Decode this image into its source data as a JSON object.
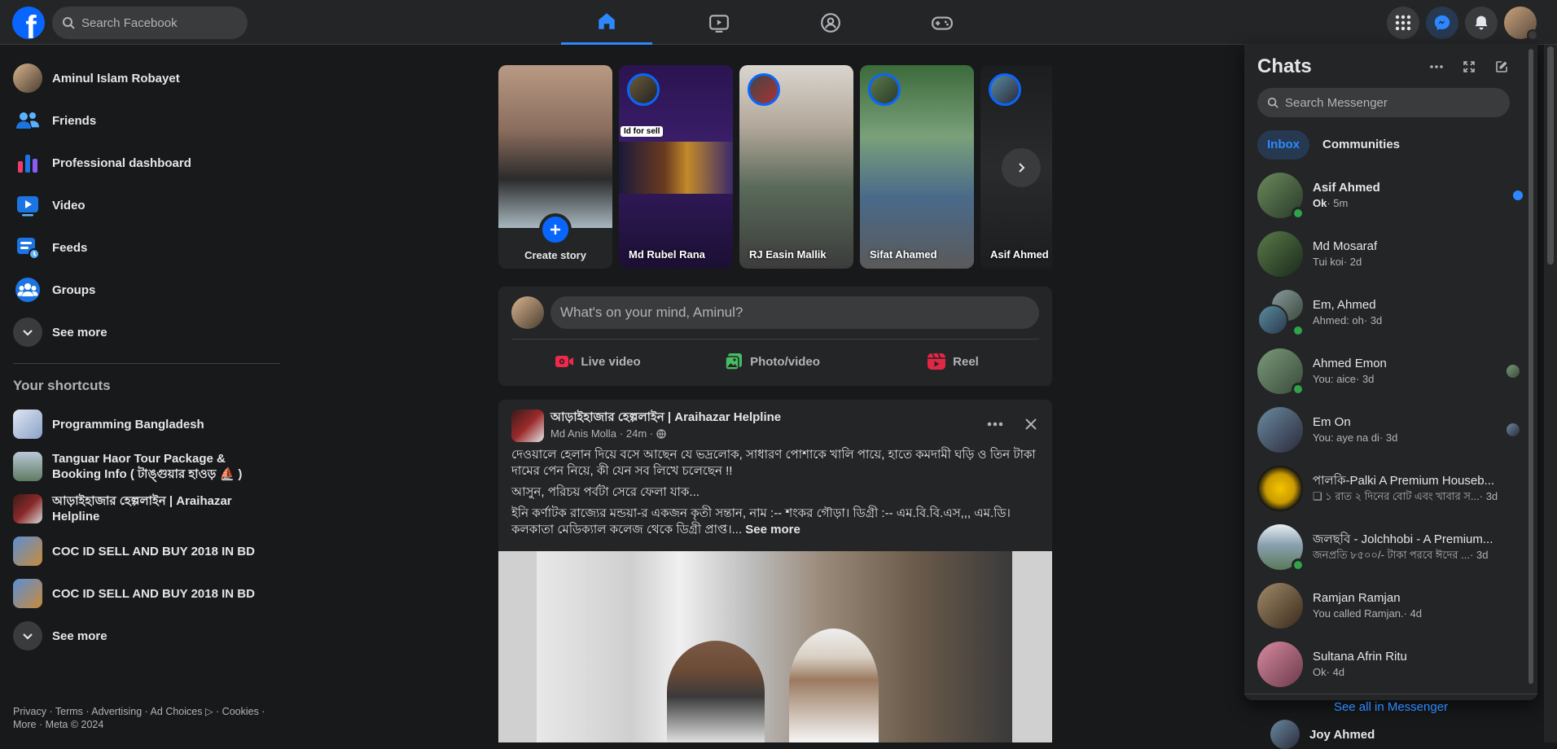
{
  "search": {
    "placeholder": "Search Facebook"
  },
  "left_nav": {
    "items": [
      {
        "label": "Aminul Islam Robayet",
        "icon": "avatar"
      },
      {
        "label": "Friends",
        "icon": "friends-icon"
      },
      {
        "label": "Professional dashboard",
        "icon": "dashboard-icon"
      },
      {
        "label": "Video",
        "icon": "video-icon"
      },
      {
        "label": "Feeds",
        "icon": "feeds-icon"
      },
      {
        "label": "Groups",
        "icon": "groups-icon"
      },
      {
        "label": "See more",
        "icon": "chevron-down-icon"
      }
    ],
    "shortcuts_title": "Your shortcuts",
    "shortcuts": [
      {
        "label": "Programming Bangladesh"
      },
      {
        "label": "Tanguar Haor Tour Package & Booking Info ( টাঙ্গুয়ার হাওড় ⛵ )"
      },
      {
        "label": "আড়াইহাজার হেল্পলাইন | Araihazar Helpline"
      },
      {
        "label": "COC ID SELL AND BUY 2018 IN BD"
      },
      {
        "label": "COC ID SELL AND BUY 2018 IN BD"
      },
      {
        "label": "See more"
      }
    ],
    "footer": "Privacy · Terms · Advertising · Ad Choices ▷ · Cookies · More · Meta © 2024"
  },
  "stories": {
    "create_label": "Create story",
    "items": [
      {
        "name": "Md Rubel Rana",
        "tag": "Id for sell"
      },
      {
        "name": "RJ Easin Mallik"
      },
      {
        "name": "Sifat Ahamed"
      },
      {
        "name": "Asif Ahmed"
      }
    ]
  },
  "composer": {
    "placeholder": "What's on your mind, Aminul?",
    "actions": [
      {
        "label": "Live video",
        "color": "#f02849"
      },
      {
        "label": "Photo/video",
        "color": "#45bd62"
      },
      {
        "label": "Reel",
        "color": "#e42645"
      }
    ]
  },
  "post": {
    "page": "আড়াইহাজার হেল্পলাইন",
    "page_suffix": " | Araihazar Helpline",
    "author": "Md Anis Molla",
    "time": "· 24m ·",
    "text1": "দেওয়ালে হেলান দিয়ে বসে আছেন যে ভদ্রলোক, সাধারণ পোশাকে খালি পায়ে, হাতে কমদামী ঘড়ি ও তিন টাকা দামের পেন নিয়ে, কী যেন সব লিখে চলেছেন !!",
    "text2": "আসুন, পরিচয় পর্বটা সেরে ফেলা যাক...",
    "text3": "ইনি কর্ণাটক রাজ্যের মন্ডয়া-র একজন কৃতী সন্তান, নাম :-- শংকর গৌড়া। ডিগ্রী :-- এম.বি.বি.এস,,, এম.ডি। কলকাতা মেডিক্যাল কলেজ থেকে ডিগ্রী প্রাপ্ত।...",
    "see_more": "See more"
  },
  "chats": {
    "title": "Chats",
    "search_placeholder": "Search Messenger",
    "tabs": [
      "Inbox",
      "Communities"
    ],
    "items": [
      {
        "name": "Asif Ahmed",
        "msg": "Ok",
        "time": " · 5m",
        "unread": true,
        "online": true
      },
      {
        "name": "Md Mosaraf",
        "msg": "Tui koi",
        "time": " · 2d",
        "online": false
      },
      {
        "name": "Em, Ahmed",
        "msg": "Ahmed: oh",
        "time": " · 3d",
        "online": true
      },
      {
        "name": "Ahmed Emon",
        "msg": "You: aice",
        "time": " · 3d",
        "online": true
      },
      {
        "name": "Em On",
        "msg": "You: aye na di",
        "time": " · 3d",
        "online": false
      },
      {
        "name": "পালকি-Palki A Premium Houseb...",
        "msg": "❏ ১ রাত ২ দিনের বোট এবং খাবার স...",
        "time": " · 3d",
        "online": false
      },
      {
        "name": "জলছবি - Jolchhobi - A Premium...",
        "msg": "জনপ্রতি ৮৫০০/- টাকা পরবে ঈদের ...",
        "time": " · 3d",
        "online": true
      },
      {
        "name": "Ramjan Ramjan",
        "msg": "You called Ramjan.",
        "time": " · 4d",
        "online": false
      },
      {
        "name": "Sultana Afrin Ritu",
        "msg": "Ok",
        "time": " · 4d",
        "online": false
      }
    ],
    "see_all": "See all in Messenger"
  },
  "contact_peek": "Joy Ahmed",
  "colors": {
    "accent": "#0866ff",
    "bg": "#18191a",
    "surface": "#242526",
    "online": "#31a24c"
  }
}
